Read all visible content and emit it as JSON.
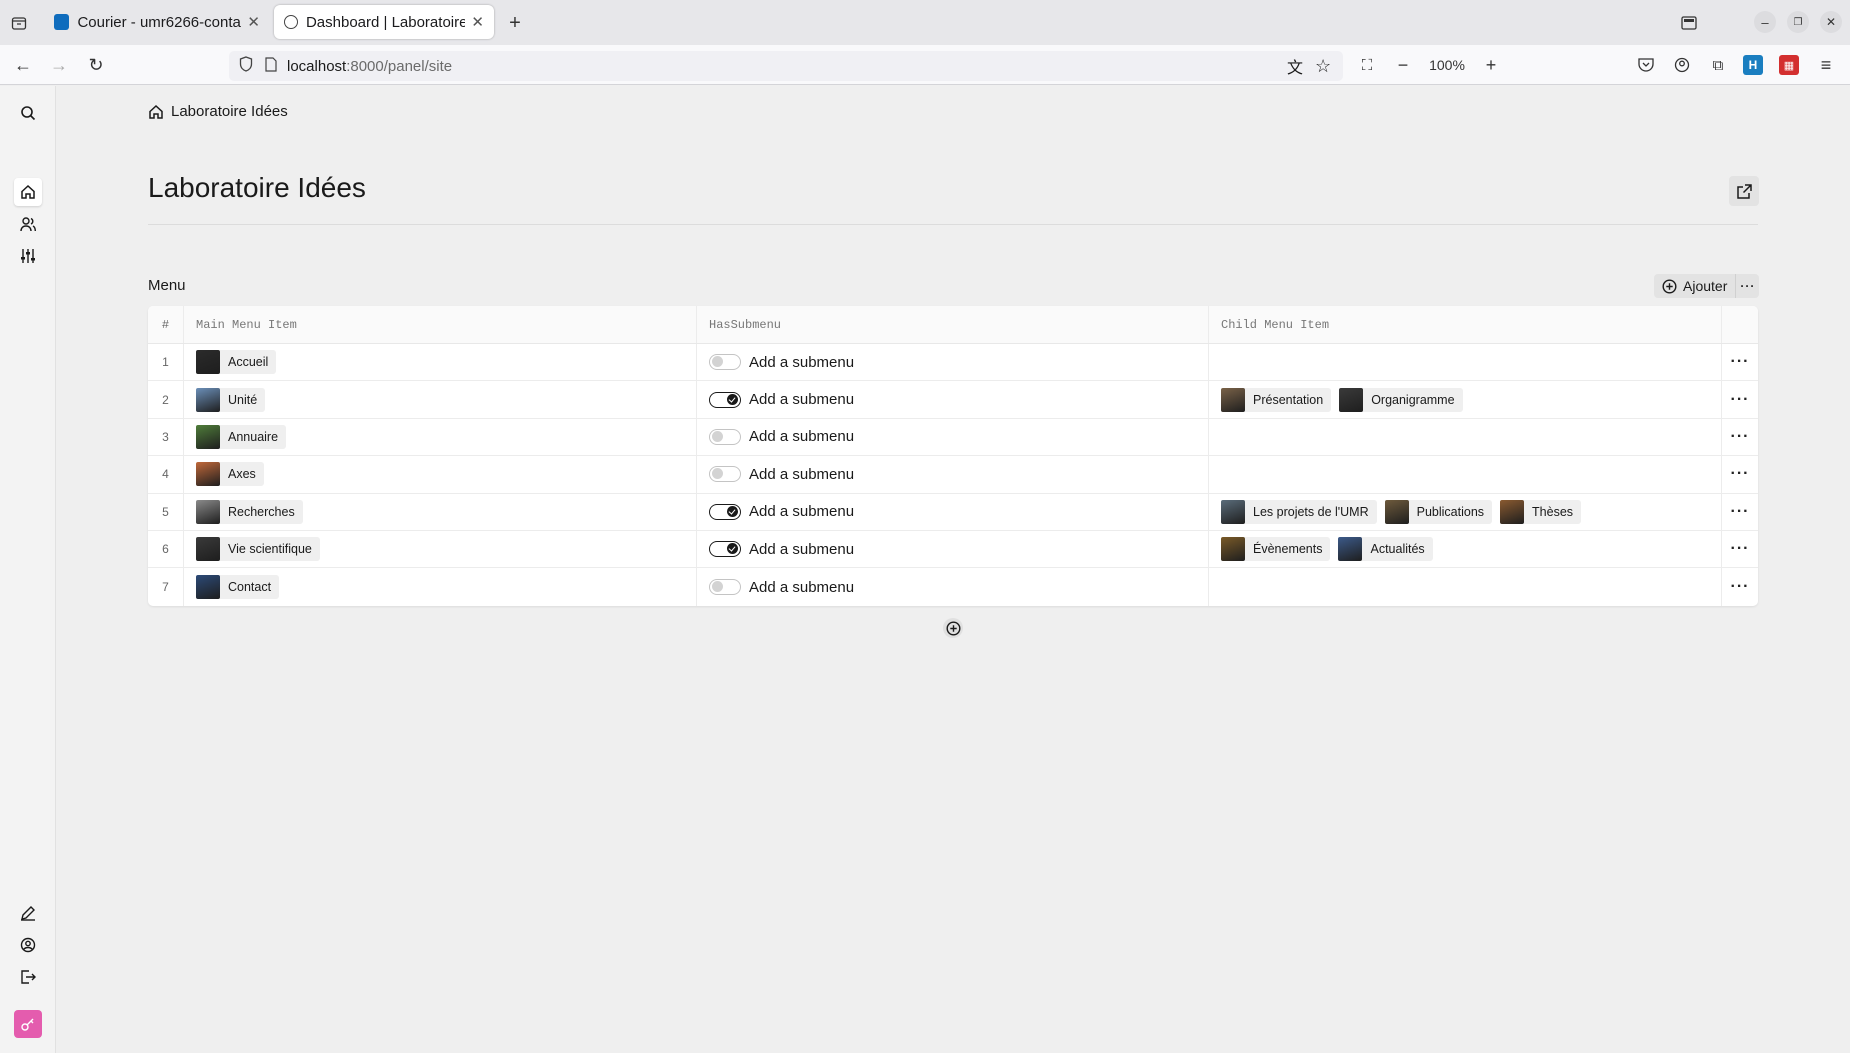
{
  "browser": {
    "tabs": [
      {
        "title": "Courier - umr6266-conta",
        "active": false,
        "icon": "outlook-icon"
      },
      {
        "title": "Dashboard | Laboratoire I",
        "active": true,
        "icon": "kirby-icon"
      }
    ],
    "url_host": "localhost",
    "url_path": ":8000/panel/site",
    "zoom": "100%"
  },
  "breadcrumb": {
    "home_label": "Laboratoire Idées"
  },
  "page": {
    "title": "Laboratoire Idées"
  },
  "section": {
    "label": "Menu",
    "add_label": "Ajouter"
  },
  "table": {
    "headers": [
      "#",
      "Main Menu Item",
      "HasSubmenu",
      "Child Menu Item"
    ],
    "submenu_label": "Add a submenu",
    "rows": [
      {
        "num": "1",
        "main": "Accueil",
        "thumb": "#2b2b2b",
        "has_submenu": false,
        "children": []
      },
      {
        "num": "2",
        "main": "Unité",
        "thumb": "#6b8fb8",
        "has_submenu": true,
        "children": [
          {
            "label": "Présentation",
            "thumb": "#7a6248"
          },
          {
            "label": "Organigramme",
            "thumb": "#3a3a3a"
          }
        ]
      },
      {
        "num": "3",
        "main": "Annuaire",
        "thumb": "#4f7d3a",
        "has_submenu": false,
        "children": []
      },
      {
        "num": "4",
        "main": "Axes",
        "thumb": "#c0683a",
        "has_submenu": false,
        "children": []
      },
      {
        "num": "5",
        "main": "Recherches",
        "thumb": "#8a8a8a",
        "has_submenu": true,
        "children": [
          {
            "label": "Les projets de l'UMR",
            "thumb": "#5a6c7a"
          },
          {
            "label": "Publications",
            "thumb": "#6e5a3c"
          },
          {
            "label": "Thèses",
            "thumb": "#8a5a30"
          }
        ]
      },
      {
        "num": "6",
        "main": "Vie scientifique",
        "thumb": "#3a3a3a",
        "has_submenu": true,
        "children": [
          {
            "label": "Évènements",
            "thumb": "#7a5a28"
          },
          {
            "label": "Actualités",
            "thumb": "#3c5a8a"
          }
        ]
      },
      {
        "num": "7",
        "main": "Contact",
        "thumb": "#2c4a78",
        "has_submenu": false,
        "children": []
      }
    ]
  }
}
